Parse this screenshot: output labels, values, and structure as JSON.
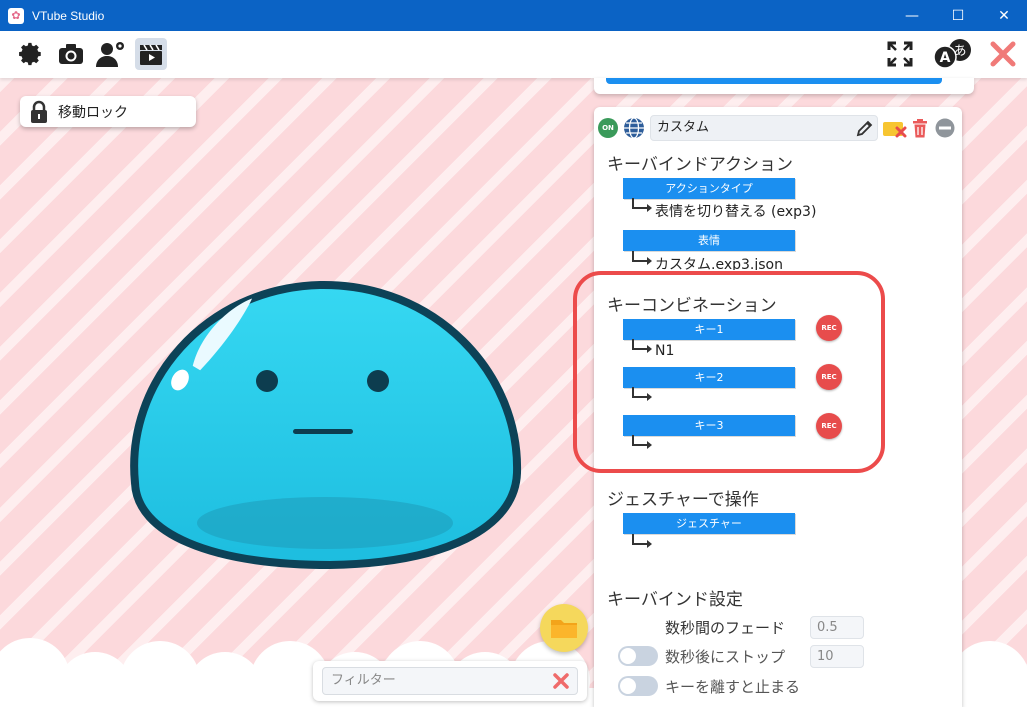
{
  "window": {
    "title": "VTube Studio",
    "minimize_glyph": "—",
    "maximize_glyph": "☐",
    "close_glyph": "✕"
  },
  "toolbar": {
    "icons": [
      "settings-gear-icon",
      "camera-icon",
      "user-settings-icon",
      "clapperboard-icon"
    ],
    "right_icons": [
      "fullscreen-icon",
      "language-icon",
      "close-app-icon"
    ]
  },
  "scene": {
    "lock_label": "移動ロック",
    "filter_placeholder": "フィルター"
  },
  "hotkey": {
    "on_badge": "ON",
    "name": "カスタム",
    "section_action": "キーバインドアクション",
    "action_type_label": "アクションタイプ",
    "action_type_value": "表情を切り替える (exp3)",
    "expression_label": "表情",
    "expression_value": "カスタム.exp3.json",
    "section_keycombo": "キーコンビネーション",
    "keys": [
      {
        "label": "キー1",
        "value": "N1"
      },
      {
        "label": "キー2",
        "value": ""
      },
      {
        "label": "キー3",
        "value": ""
      }
    ],
    "rec_label": "REC",
    "section_gesture": "ジェスチャーで操作",
    "gesture_label": "ジェスチャー",
    "gesture_value": "",
    "section_settings": "キーバインド設定",
    "fade_label": "数秒間のフェード",
    "fade_value": "0.5",
    "stop_after_label": "数秒後にストップ",
    "stop_after_value": "10",
    "stop_on_release_label": "キーを離すと止まる"
  },
  "colors": {
    "titlebar": "#0b63c5",
    "accent_blue": "#1b8ff0",
    "rec_red": "#e74c4c",
    "highlight_red": "#ec4b4b",
    "on_green": "#3a9a5a",
    "background_pink": "#fcd9dc",
    "slime_cyan": "#2ad3ef"
  }
}
